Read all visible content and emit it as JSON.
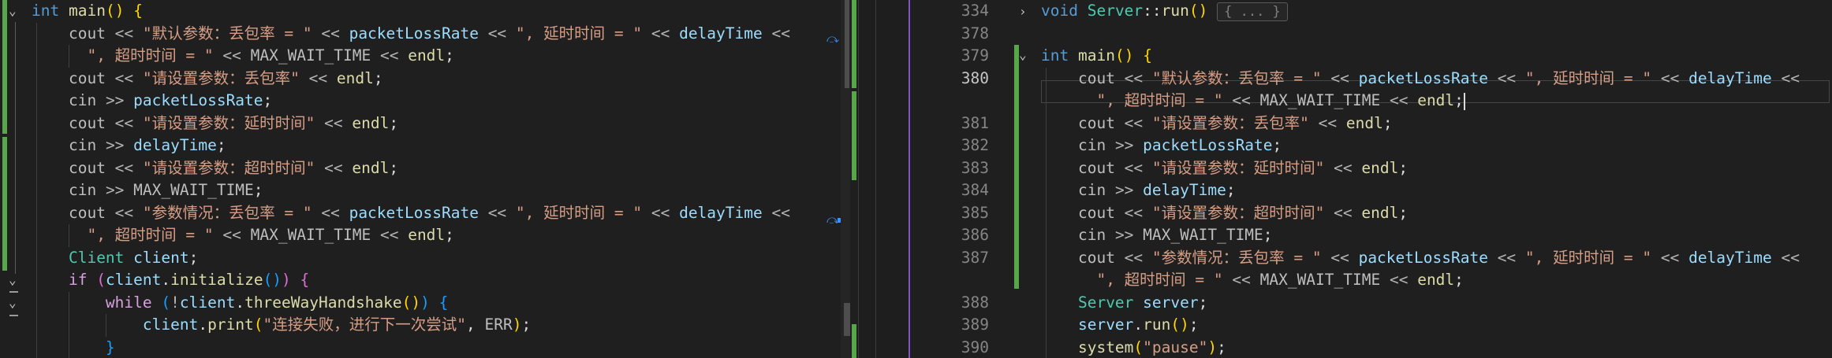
{
  "colors": {
    "editor_bg": "#1f1f1f",
    "change_marker": "#57a64a",
    "split_accent": "#7e57c2",
    "keyword": "#569cd6",
    "control": "#d8a0df",
    "function": "#dcdcaa",
    "string": "#d69d85",
    "variable": "#9cdcfe",
    "type": "#4ec9b0",
    "line_number": "#858585"
  },
  "left_pane": {
    "lines": [
      [
        [
          "int",
          "kw"
        ],
        [
          " ",
          "id"
        ],
        [
          "main",
          "fn"
        ],
        [
          "()",
          "p1"
        ],
        [
          " ",
          "id"
        ],
        [
          "{",
          "p1"
        ]
      ],
      [
        [
          "    ",
          "id"
        ],
        [
          "cout",
          "mac"
        ],
        [
          " << ",
          "op"
        ],
        [
          "\"默认参数：丢包率 = \"",
          "str"
        ],
        [
          " << ",
          "op"
        ],
        [
          "packetLossRate",
          "var"
        ],
        [
          " << ",
          "op"
        ],
        [
          "\", 延时时间 = \"",
          "str"
        ],
        [
          " << ",
          "op"
        ],
        [
          "delayTime",
          "var"
        ],
        [
          " <<",
          "op"
        ]
      ],
      [
        [
          "      ",
          "id"
        ],
        [
          "\", 超时时间 = \"",
          "str"
        ],
        [
          " << ",
          "op"
        ],
        [
          "MAX_WAIT_TIME",
          "mac"
        ],
        [
          " << ",
          "op"
        ],
        [
          "endl",
          "fn"
        ],
        [
          ";",
          "id"
        ]
      ],
      [
        [
          "    ",
          "id"
        ],
        [
          "cout",
          "mac"
        ],
        [
          " << ",
          "op"
        ],
        [
          "\"请设置参数：丢包率\"",
          "str"
        ],
        [
          " << ",
          "op"
        ],
        [
          "endl",
          "fn"
        ],
        [
          ";",
          "id"
        ]
      ],
      [
        [
          "    ",
          "id"
        ],
        [
          "cin",
          "mac"
        ],
        [
          " >> ",
          "op"
        ],
        [
          "packetLossRate",
          "var"
        ],
        [
          ";",
          "id"
        ]
      ],
      [
        [
          "    ",
          "id"
        ],
        [
          "cout",
          "mac"
        ],
        [
          " << ",
          "op"
        ],
        [
          "\"请设置参数：延时时间\"",
          "str"
        ],
        [
          " << ",
          "op"
        ],
        [
          "endl",
          "fn"
        ],
        [
          ";",
          "id"
        ]
      ],
      [
        [
          "    ",
          "id"
        ],
        [
          "cin",
          "mac"
        ],
        [
          " >> ",
          "op"
        ],
        [
          "delayTime",
          "var"
        ],
        [
          ";",
          "id"
        ]
      ],
      [
        [
          "    ",
          "id"
        ],
        [
          "cout",
          "mac"
        ],
        [
          " << ",
          "op"
        ],
        [
          "\"请设置参数：超时时间\"",
          "str"
        ],
        [
          " << ",
          "op"
        ],
        [
          "endl",
          "fn"
        ],
        [
          ";",
          "id"
        ]
      ],
      [
        [
          "    ",
          "id"
        ],
        [
          "cin",
          "mac"
        ],
        [
          " >> ",
          "op"
        ],
        [
          "MAX_WAIT_TIME",
          "mac"
        ],
        [
          ";",
          "id"
        ]
      ],
      [
        [
          "    ",
          "id"
        ],
        [
          "cout",
          "mac"
        ],
        [
          " << ",
          "op"
        ],
        [
          "\"参数情况：丢包率 = \"",
          "str"
        ],
        [
          " << ",
          "op"
        ],
        [
          "packetLossRate",
          "var"
        ],
        [
          " << ",
          "op"
        ],
        [
          "\", 延时时间 = \"",
          "str"
        ],
        [
          " << ",
          "op"
        ],
        [
          "delayTime",
          "var"
        ],
        [
          " <<",
          "op"
        ]
      ],
      [
        [
          "      ",
          "id"
        ],
        [
          "\", 超时时间 = \"",
          "str"
        ],
        [
          " << ",
          "op"
        ],
        [
          "MAX_WAIT_TIME",
          "mac"
        ],
        [
          " << ",
          "op"
        ],
        [
          "endl",
          "fn"
        ],
        [
          ";",
          "id"
        ]
      ],
      [
        [
          "    ",
          "id"
        ],
        [
          "Client",
          "type"
        ],
        [
          " ",
          "id"
        ],
        [
          "client",
          "var"
        ],
        [
          ";",
          "id"
        ]
      ],
      [
        [
          "    ",
          "id"
        ],
        [
          "if",
          "ctl"
        ],
        [
          " ",
          "id"
        ],
        [
          "(",
          "p2"
        ],
        [
          "client",
          "var"
        ],
        [
          ".",
          "id"
        ],
        [
          "initialize",
          "fn"
        ],
        [
          "()",
          "p3"
        ],
        [
          ")",
          "p2"
        ],
        [
          " ",
          "id"
        ],
        [
          "{",
          "p2"
        ]
      ],
      [
        [
          "        ",
          "id"
        ],
        [
          "while",
          "ctl"
        ],
        [
          " ",
          "id"
        ],
        [
          "(",
          "p3"
        ],
        [
          "!",
          "op"
        ],
        [
          "client",
          "var"
        ],
        [
          ".",
          "id"
        ],
        [
          "threeWayHandshake",
          "fn"
        ],
        [
          "()",
          "p1"
        ],
        [
          ")",
          "p3"
        ],
        [
          " ",
          "id"
        ],
        [
          "{",
          "p3"
        ]
      ],
      [
        [
          "            ",
          "id"
        ],
        [
          "client",
          "var"
        ],
        [
          ".",
          "id"
        ],
        [
          "print",
          "fn"
        ],
        [
          "(",
          "p1"
        ],
        [
          "\"连接失败，进行下一次尝试\"",
          "str"
        ],
        [
          ", ",
          "id"
        ],
        [
          "ERR",
          "mac"
        ],
        [
          ")",
          "p1"
        ],
        [
          ";",
          "id"
        ]
      ],
      [
        [
          "        ",
          "id"
        ],
        [
          "}",
          "p3"
        ]
      ]
    ]
  },
  "right_pane": {
    "line_numbers": [
      "334",
      "378",
      "379",
      "380",
      "",
      "381",
      "382",
      "383",
      "384",
      "385",
      "386",
      "387",
      "",
      "388",
      "389",
      "390"
    ],
    "active_line": "380",
    "fold_placeholder": "{ ... }",
    "lines": [
      [
        [
          "void",
          "kw"
        ],
        [
          " ",
          "id"
        ],
        [
          "Server",
          "type"
        ],
        [
          "::",
          "id"
        ],
        [
          "run",
          "fn"
        ],
        [
          "()",
          "p1"
        ]
      ],
      [],
      [
        [
          "int",
          "kw"
        ],
        [
          " ",
          "id"
        ],
        [
          "main",
          "fn"
        ],
        [
          "()",
          "p1"
        ],
        [
          " ",
          "id"
        ],
        [
          "{",
          "p1"
        ]
      ],
      [
        [
          "    ",
          "id"
        ],
        [
          "cout",
          "mac"
        ],
        [
          " << ",
          "op"
        ],
        [
          "\"默认参数：丢包率 = \"",
          "str"
        ],
        [
          " << ",
          "op"
        ],
        [
          "packetLossRate",
          "var"
        ],
        [
          " << ",
          "op"
        ],
        [
          "\", 延时时间 = \"",
          "str"
        ],
        [
          " << ",
          "op"
        ],
        [
          "delayTime",
          "var"
        ],
        [
          " <<",
          "op"
        ]
      ],
      [
        [
          "      ",
          "id"
        ],
        [
          "\", 超时时间 = \"",
          "str"
        ],
        [
          " << ",
          "op"
        ],
        [
          "MAX_WAIT_TIME",
          "mac"
        ],
        [
          " << ",
          "op"
        ],
        [
          "endl",
          "fn"
        ],
        [
          ";",
          "id"
        ]
      ],
      [
        [
          "    ",
          "id"
        ],
        [
          "cout",
          "mac"
        ],
        [
          " << ",
          "op"
        ],
        [
          "\"请设置参数：丢包率\"",
          "str"
        ],
        [
          " << ",
          "op"
        ],
        [
          "endl",
          "fn"
        ],
        [
          ";",
          "id"
        ]
      ],
      [
        [
          "    ",
          "id"
        ],
        [
          "cin",
          "mac"
        ],
        [
          " >> ",
          "op"
        ],
        [
          "packetLossRate",
          "var"
        ],
        [
          ";",
          "id"
        ]
      ],
      [
        [
          "    ",
          "id"
        ],
        [
          "cout",
          "mac"
        ],
        [
          " << ",
          "op"
        ],
        [
          "\"请设置参数：延时时间\"",
          "str"
        ],
        [
          " << ",
          "op"
        ],
        [
          "endl",
          "fn"
        ],
        [
          ";",
          "id"
        ]
      ],
      [
        [
          "    ",
          "id"
        ],
        [
          "cin",
          "mac"
        ],
        [
          " >> ",
          "op"
        ],
        [
          "delayTime",
          "var"
        ],
        [
          ";",
          "id"
        ]
      ],
      [
        [
          "    ",
          "id"
        ],
        [
          "cout",
          "mac"
        ],
        [
          " << ",
          "op"
        ],
        [
          "\"请设置参数：超时时间\"",
          "str"
        ],
        [
          " << ",
          "op"
        ],
        [
          "endl",
          "fn"
        ],
        [
          ";",
          "id"
        ]
      ],
      [
        [
          "    ",
          "id"
        ],
        [
          "cin",
          "mac"
        ],
        [
          " >> ",
          "op"
        ],
        [
          "MAX_WAIT_TIME",
          "mac"
        ],
        [
          ";",
          "id"
        ]
      ],
      [
        [
          "    ",
          "id"
        ],
        [
          "cout",
          "mac"
        ],
        [
          " << ",
          "op"
        ],
        [
          "\"参数情况：丢包率 = \"",
          "str"
        ],
        [
          " << ",
          "op"
        ],
        [
          "packetLossRate",
          "var"
        ],
        [
          " << ",
          "op"
        ],
        [
          "\", 延时时间 = \"",
          "str"
        ],
        [
          " << ",
          "op"
        ],
        [
          "delayTime",
          "var"
        ],
        [
          " <<",
          "op"
        ]
      ],
      [
        [
          "      ",
          "id"
        ],
        [
          "\", 超时时间 = \"",
          "str"
        ],
        [
          " << ",
          "op"
        ],
        [
          "MAX_WAIT_TIME",
          "mac"
        ],
        [
          " << ",
          "op"
        ],
        [
          "endl",
          "fn"
        ],
        [
          ";",
          "id"
        ]
      ],
      [
        [
          "    ",
          "id"
        ],
        [
          "Server",
          "type"
        ],
        [
          " ",
          "id"
        ],
        [
          "server",
          "var"
        ],
        [
          ";",
          "id"
        ]
      ],
      [
        [
          "    ",
          "id"
        ],
        [
          "server",
          "var"
        ],
        [
          ".",
          "id"
        ],
        [
          "run",
          "fn"
        ],
        [
          "()",
          "p1"
        ],
        [
          ";",
          "id"
        ]
      ],
      [
        [
          "    ",
          "id"
        ],
        [
          "system",
          "fn"
        ],
        [
          "(",
          "p1"
        ],
        [
          "\"pause\"",
          "str"
        ],
        [
          ")",
          "p1"
        ],
        [
          ";",
          "id"
        ]
      ]
    ]
  }
}
